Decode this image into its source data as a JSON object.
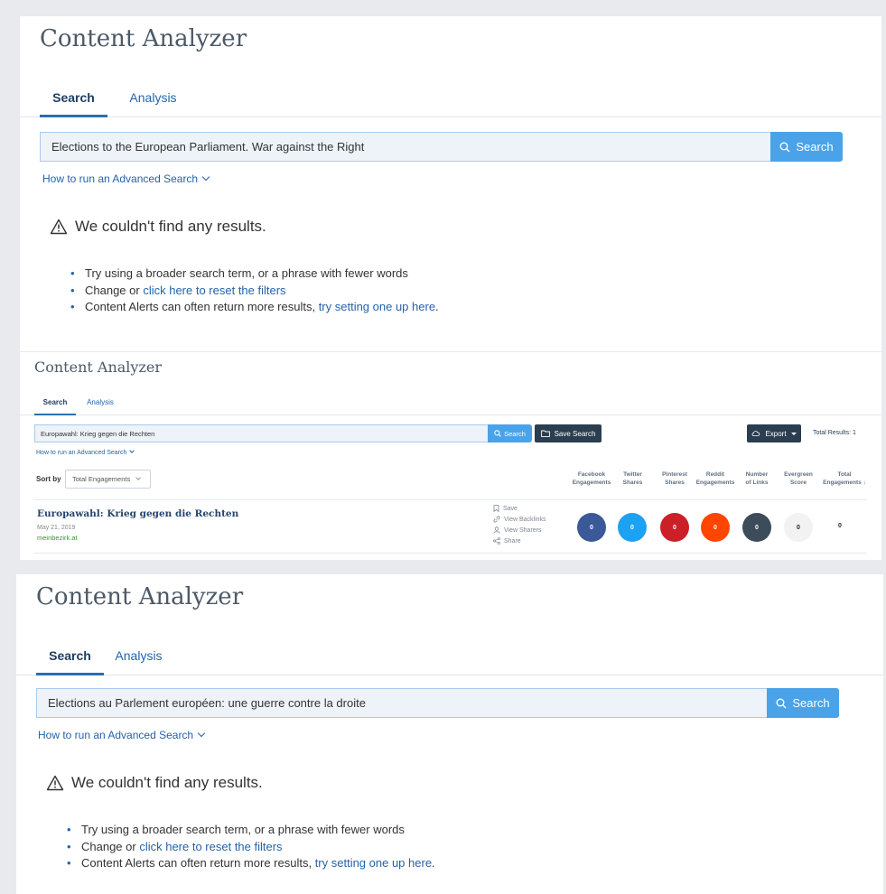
{
  "panel1": {
    "title": "Content Analyzer",
    "tabs": [
      "Search",
      "Analysis"
    ],
    "search_value": "Elections to the European Parliament. War against the Right",
    "search_button": "Search",
    "advanced_link": "How to run an Advanced Search",
    "no_results": "We couldn't find any results.",
    "tip1": "Try using a broader search term, or a phrase with fewer words",
    "tip2_prefix": "Change or ",
    "tip2_link": "click here to reset the filters",
    "tip3_prefix": "Content Alerts can often return more results, ",
    "tip3_link": "try setting one up here",
    "tip3_suffix": "."
  },
  "panel2": {
    "title": "Content Analyzer",
    "tabs": [
      "Search",
      "Analysis"
    ],
    "search_value": "Europawahl: Krieg gegen die Rechten",
    "search_button": "Search",
    "save_search": "Save Search",
    "export": "Export",
    "total_results": "Total Results: 1",
    "advanced_link": "How to run an Advanced Search",
    "sort_label": "Sort by",
    "sort_value": "Total Engagements",
    "columns": [
      [
        "Facebook",
        "Engagements"
      ],
      [
        "Twitter",
        "Shares"
      ],
      [
        "Pinterest",
        "Shares"
      ],
      [
        "Reddit",
        "Engagements"
      ],
      [
        "Number",
        "of Links"
      ],
      [
        "Evergreen",
        "Score"
      ],
      [
        "Total",
        "Engagements ↓"
      ]
    ],
    "article": {
      "title": "Europawahl: Krieg gegen die Rechten",
      "date": "May 21, 2019",
      "domain": "meinbezirk.at",
      "actions": [
        "Save",
        "View Backlinks",
        "View Sharers",
        "Share"
      ],
      "values": [
        "0",
        "0",
        "0",
        "0",
        "0",
        "0",
        "0"
      ]
    },
    "colors": {
      "facebook": "#3b5998",
      "twitter": "#1da1f2",
      "pinterest": "#cb2027",
      "reddit": "#ff4500",
      "links": "#3d4b5a",
      "evergreen": "#f2f2f2"
    }
  },
  "panel3": {
    "title": "Content Analyzer",
    "tabs": [
      "Search",
      "Analysis"
    ],
    "search_value": "Elections au Parlement européen: une guerre contre la droite",
    "search_button": "Search",
    "advanced_link": "How to run an Advanced Search",
    "no_results": "We couldn't find any results.",
    "tip1": "Try using a broader search term, or a phrase with fewer words",
    "tip2_prefix": "Change or ",
    "tip2_link": "click here to reset the filters",
    "tip3_prefix": "Content Alerts can often return more results, ",
    "tip3_link": "try setting one up here",
    "tip3_suffix": "."
  }
}
